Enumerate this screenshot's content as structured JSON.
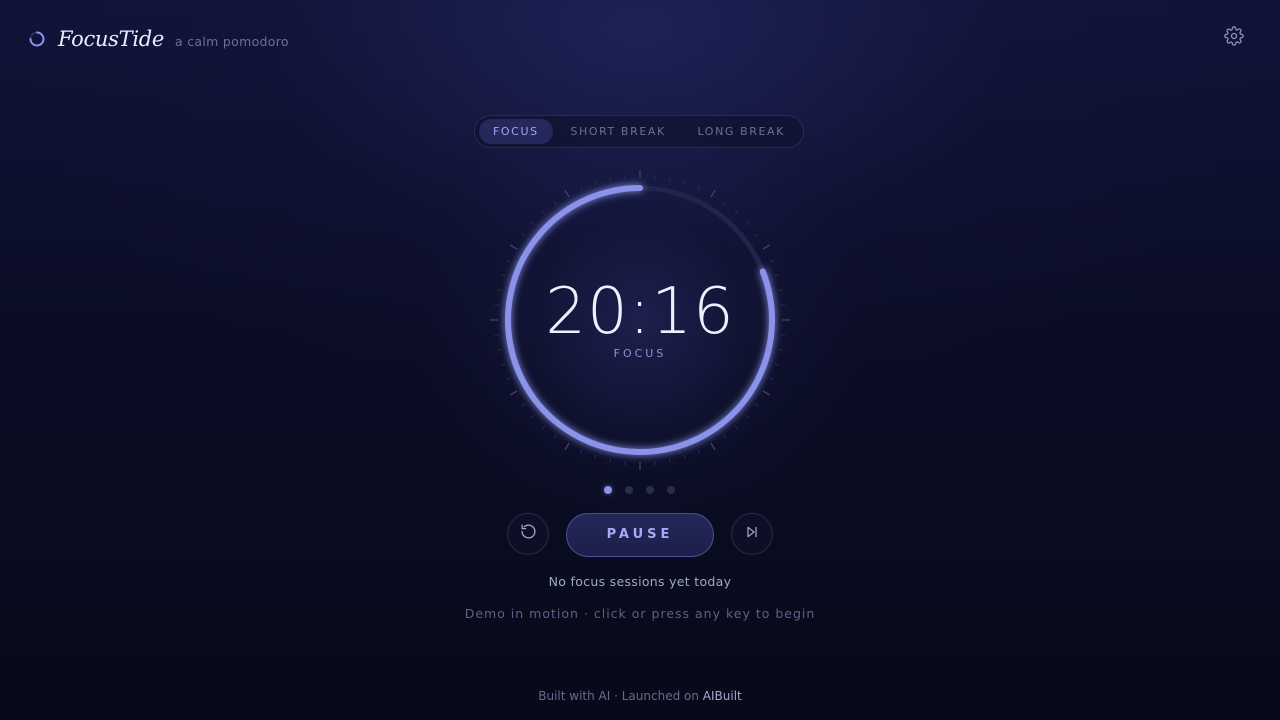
{
  "header": {
    "app_name": "FocusTide",
    "tagline": "a calm pomodoro",
    "logo_icon": "ring-logo-icon",
    "settings_icon": "gear-icon"
  },
  "tabs": [
    {
      "label": "FOCUS",
      "active": true
    },
    {
      "label": "SHORT BREAK",
      "active": false
    },
    {
      "label": "LONG BREAK",
      "active": false
    }
  ],
  "timer": {
    "time": "20:16",
    "mode_label": "FOCUS",
    "progress_remaining": 0.81
  },
  "sessions": {
    "total": 4,
    "current": 1
  },
  "controls": {
    "reset_icon": "reset-icon",
    "pause_label": "PAUSE",
    "skip_icon": "skip-icon"
  },
  "status_text": "No focus sessions yet today",
  "hint_text": "Demo in motion · click or press any key to begin",
  "footer": {
    "prefix": "Built with AI · Launched on ",
    "link": "AIBuilt"
  },
  "colors": {
    "accent": "#8a92ea",
    "background": "#0b0d26",
    "track": "#22254a"
  }
}
